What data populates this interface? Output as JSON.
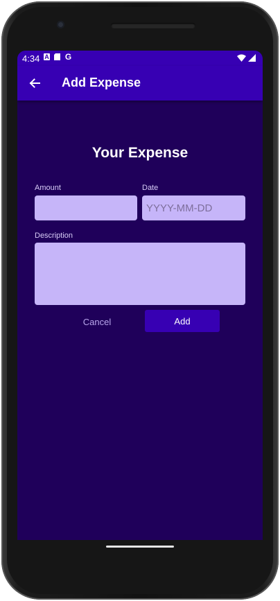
{
  "status_bar": {
    "time": "4:34",
    "icons_left": [
      "a-icon",
      "sd-card-icon",
      "google-icon"
    ],
    "icons_right": [
      "wifi-icon",
      "cell-signal-icon"
    ]
  },
  "app_bar": {
    "title": "Add Expense",
    "back_icon": "arrow-back-icon"
  },
  "form": {
    "heading": "Your Expense",
    "amount": {
      "label": "Amount",
      "value": "",
      "placeholder": ""
    },
    "date": {
      "label": "Date",
      "value": "",
      "placeholder": "YYYY-MM-DD"
    },
    "description": {
      "label": "Description",
      "value": "",
      "placeholder": ""
    },
    "cancel_label": "Cancel",
    "add_label": "Add"
  },
  "colors": {
    "app_bar": "#3700b3",
    "background": "#1f005a",
    "field": "#c6b5f9",
    "cancel_text": "#b9a6ec"
  }
}
